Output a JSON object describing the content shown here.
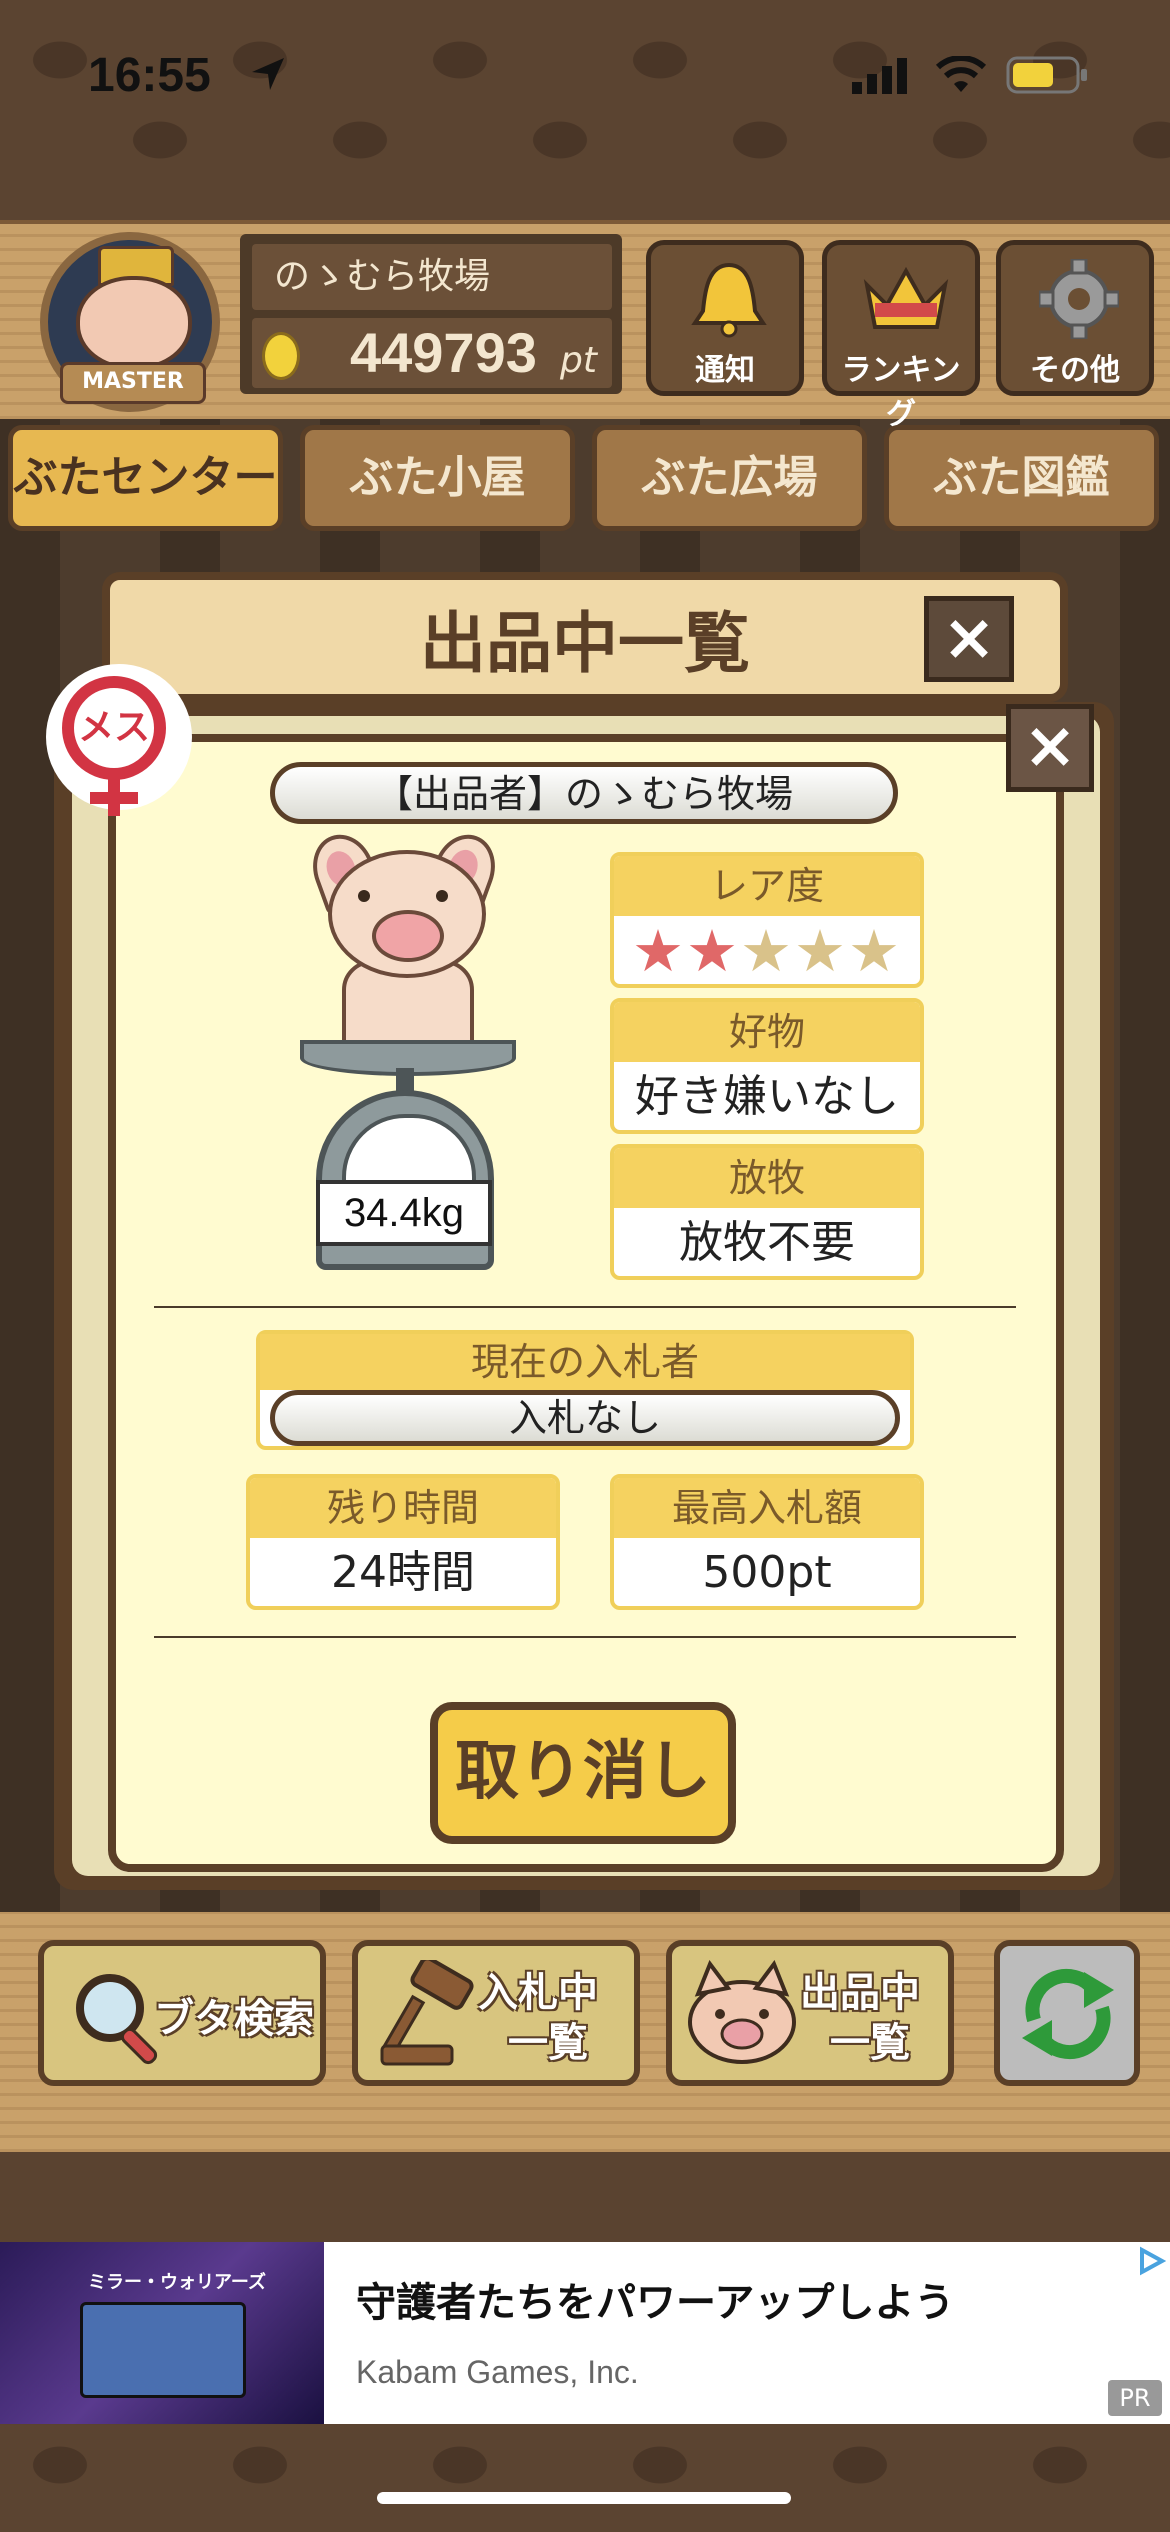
{
  "status_bar": {
    "time": "16:55"
  },
  "header": {
    "badge_label": "MASTER",
    "farm_name": "のゝむら牧場",
    "points": "449793",
    "points_unit": "pt",
    "buttons": [
      {
        "label": "通知",
        "icon": "bell-icon"
      },
      {
        "label": "ランキング",
        "icon": "crown-icon"
      },
      {
        "label": "その他",
        "icon": "gear-icon"
      }
    ]
  },
  "nav_tabs": [
    "ぶたセンター",
    "ぶた小屋",
    "ぶた広場",
    "ぶた図鑑"
  ],
  "panel": {
    "title": "出品中一覧",
    "close": "×"
  },
  "modal": {
    "close": "×",
    "gender": "メス",
    "seller": "【出品者】のゝむら牧場",
    "weight": "34.4kg",
    "rarity": {
      "label": "レア度",
      "stars_filled": 2,
      "stars_total": 5,
      "filled_char": "★★",
      "empty_char": "★★★"
    },
    "favorite": {
      "label": "好物",
      "value": "好き嫌いなし"
    },
    "grazing": {
      "label": "放牧",
      "value": "放牧不要"
    },
    "current_bidder": {
      "label": "現在の入札者",
      "value": "入札なし"
    },
    "time_left": {
      "label": "残り時間",
      "value": "24時間"
    },
    "highest_bid": {
      "label": "最高入札額",
      "value": "500pt"
    },
    "cancel_button": "取り消し"
  },
  "toolbar": [
    {
      "label": "ブタ検索",
      "icon": "magnifier-icon"
    },
    {
      "label_line1": "入札中",
      "label_line2": "一覧",
      "icon": "gavel-icon"
    },
    {
      "label_line1": "出品中",
      "label_line2": "一覧",
      "icon": "pig-face-icon"
    },
    {
      "icon": "refresh-icon"
    }
  ],
  "ad": {
    "title": "守護者たちをパワーアップしよう",
    "advertiser": "Kabam Games, Inc.",
    "badge": "PR",
    "image_caption": "ミラー・ウォリアーズ"
  },
  "colors": {
    "accent": "#f5cc49",
    "dark_wood": "#5a3f27",
    "female": "#d23443",
    "star_on": "#e06868"
  }
}
